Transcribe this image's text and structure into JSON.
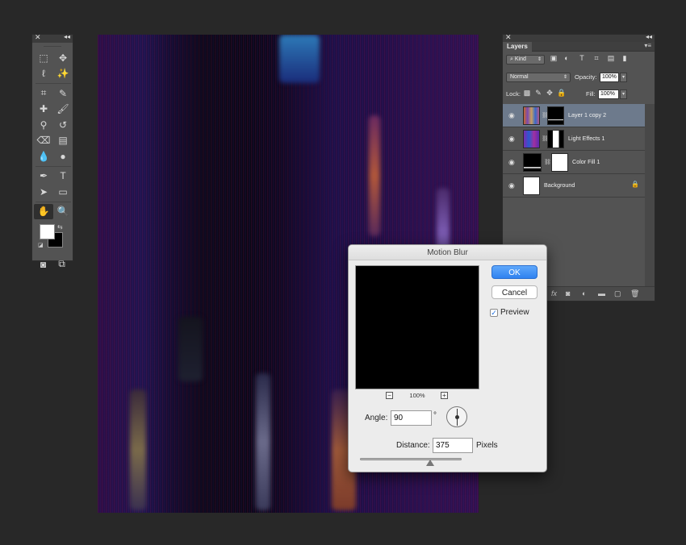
{
  "toolbox": {
    "tools": [
      {
        "name": "marquee-tool-icon",
        "glyph": "⬚"
      },
      {
        "name": "move-tool-icon",
        "glyph": "✥"
      },
      {
        "name": "lasso-tool-icon",
        "glyph": "ℓ"
      },
      {
        "name": "magic-wand-tool-icon",
        "glyph": "✨"
      },
      {
        "name": "crop-tool-icon",
        "glyph": "⌗"
      },
      {
        "name": "eyedropper-tool-icon",
        "glyph": "✎"
      },
      {
        "name": "healing-brush-tool-icon",
        "glyph": "✚"
      },
      {
        "name": "brush-tool-icon",
        "glyph": "🖌"
      },
      {
        "name": "clone-stamp-tool-icon",
        "glyph": "⚲"
      },
      {
        "name": "history-brush-tool-icon",
        "glyph": "↺"
      },
      {
        "name": "eraser-tool-icon",
        "glyph": "⌫"
      },
      {
        "name": "gradient-tool-icon",
        "glyph": "▤"
      },
      {
        "name": "blur-tool-icon",
        "glyph": "💧"
      },
      {
        "name": "dodge-tool-icon",
        "glyph": "●"
      },
      {
        "name": "pen-tool-icon",
        "glyph": "✒"
      },
      {
        "name": "type-tool-icon",
        "glyph": "T"
      },
      {
        "name": "path-selection-tool-icon",
        "glyph": "➤"
      },
      {
        "name": "rectangle-tool-icon",
        "glyph": "▭"
      },
      {
        "name": "hand-tool-icon",
        "glyph": "✋",
        "active": true
      },
      {
        "name": "zoom-tool-icon",
        "glyph": "🔍"
      }
    ],
    "foreground_color": "#ffffff",
    "background_color": "#000000",
    "bottom": [
      {
        "name": "quick-mask-icon",
        "glyph": "◙"
      },
      {
        "name": "screen-mode-icon",
        "glyph": "⧉"
      }
    ]
  },
  "layers_panel": {
    "tab_label": "Layers",
    "filter_kind": "Kind",
    "blend_mode": "Normal",
    "opacity_label": "Opacity:",
    "opacity_value": "100%",
    "lock_label": "Lock:",
    "fill_label": "Fill:",
    "fill_value": "100%",
    "layers": [
      {
        "name": "Layer 1 copy 2",
        "selected": true
      },
      {
        "name": "Light Effects 1",
        "selected": false
      },
      {
        "name": "Color Fill 1",
        "selected": false
      },
      {
        "name": "Background",
        "selected": false,
        "locked": true
      }
    ]
  },
  "dialog": {
    "title": "Motion Blur",
    "ok_label": "OK",
    "cancel_label": "Cancel",
    "preview_label": "Preview",
    "preview_checked": true,
    "zoom_level": "100%",
    "zoom_out": "−",
    "zoom_in": "+",
    "angle_label": "Angle:",
    "angle_value": "90",
    "degree_symbol": "°",
    "distance_label": "Distance:",
    "distance_value": "375",
    "distance_unit": "Pixels",
    "distance_slider_fraction": 0.69
  }
}
